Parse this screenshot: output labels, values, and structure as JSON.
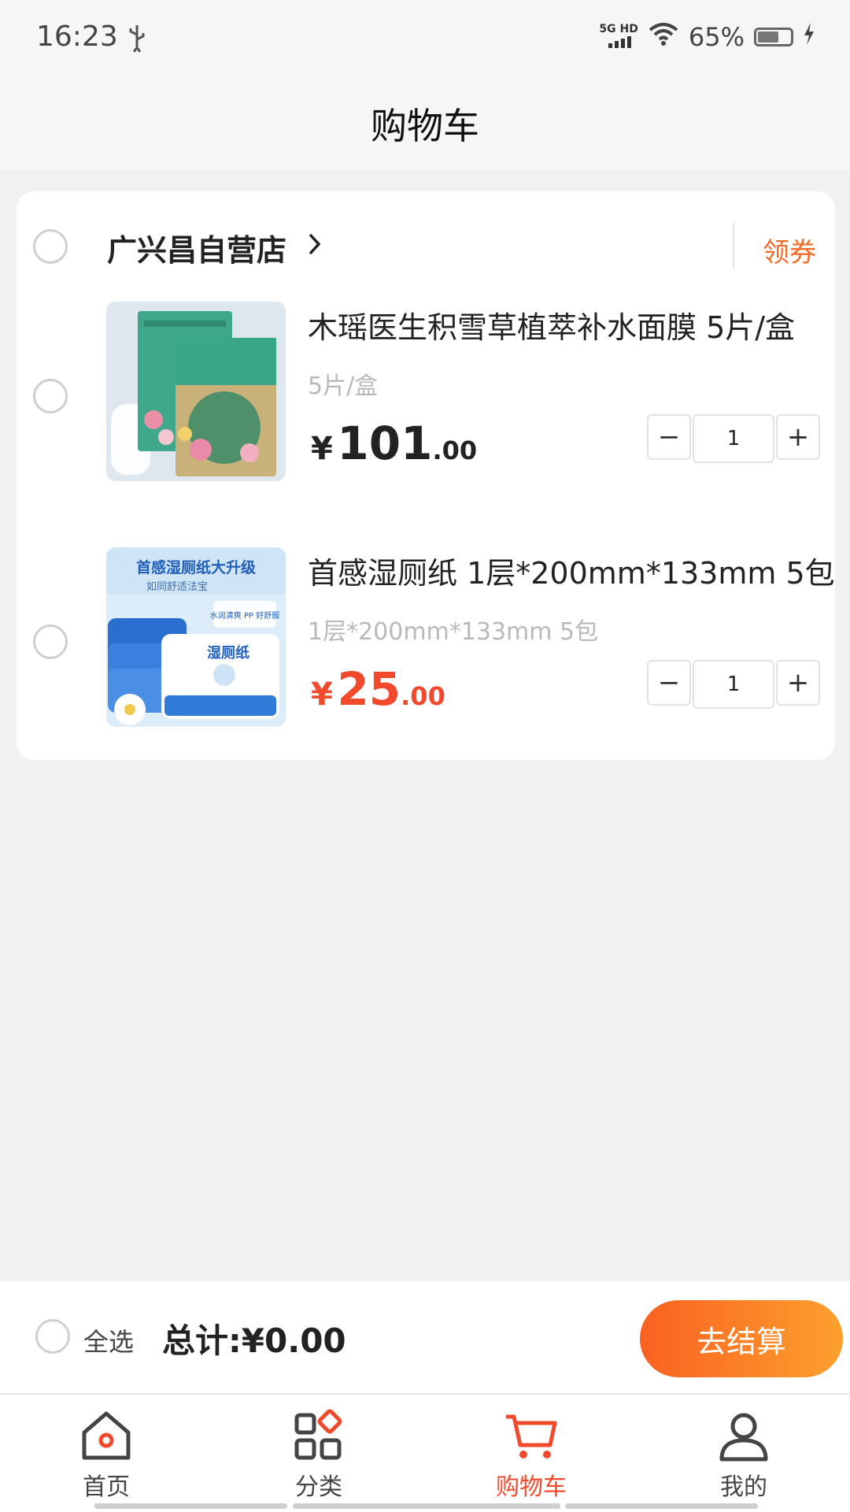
{
  "status_bar": {
    "time": "16:23",
    "network": "5G HD",
    "battery": "65%"
  },
  "header": {
    "title": "购物车"
  },
  "store": {
    "name": "广兴昌自营店",
    "coupon_label": "领券"
  },
  "products": [
    {
      "name": "木瑶医生积雪草植萃补水面膜 5片/盒",
      "spec": "5片/盒",
      "currency": "¥",
      "price_int": "101",
      "price_dec": ".00",
      "price_color": "#222222",
      "quantity": "1"
    },
    {
      "name": "首感湿厕纸 1层*200mm*133mm 5包",
      "spec": "1层*200mm*133mm 5包",
      "currency": "¥",
      "price_int": "25",
      "price_dec": ".00",
      "price_color": "#f1492c",
      "quantity": "1",
      "image_text": {
        "headline": "首感湿厕纸大升级",
        "subline": "如同舒适法宝",
        "badge": "水润清爽 PP 好舒服",
        "package": "湿厕纸"
      }
    }
  ],
  "stepper": {
    "minus": "−",
    "plus": "+"
  },
  "checkout": {
    "select_all": "全选",
    "total": "总计:¥0.00",
    "button": "去结算"
  },
  "tabs": [
    {
      "label": "首页",
      "icon": "home-icon"
    },
    {
      "label": "分类",
      "icon": "category-icon"
    },
    {
      "label": "购物车",
      "icon": "cart-icon",
      "active": true
    },
    {
      "label": "我的",
      "icon": "user-icon"
    }
  ],
  "colors": {
    "accent": "#f26b28",
    "active_tab": "#f1492c",
    "checkout_gradient_start": "#fa6121",
    "checkout_gradient_end": "#fca02e"
  }
}
